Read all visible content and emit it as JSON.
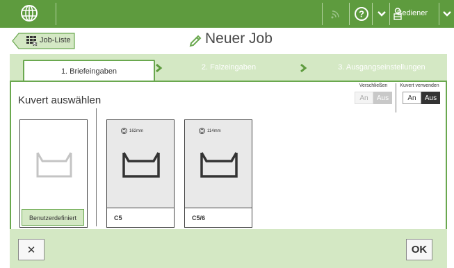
{
  "topbar": {
    "user_label": "Bediener"
  },
  "header": {
    "back_label": "Job-Liste",
    "title": "Neuer Job"
  },
  "tabs": [
    {
      "label": "1. Briefeingaben",
      "active": true
    },
    {
      "label": "2. Falzeingaben",
      "active": false
    },
    {
      "label": "3. Ausgangseinstellungen",
      "active": false
    }
  ],
  "panel": {
    "section_title": "Kuvert auswählen",
    "seal": {
      "label": "Verschließen",
      "on_label": "An",
      "off_label": "Aus",
      "enabled": false
    },
    "use_envelope": {
      "label": "Kuvert verwenden",
      "on_label": "An",
      "off_label": "Aus",
      "selected": "Aus"
    },
    "cards": [
      {
        "name": "Benutzerdefiniert",
        "size": ""
      },
      {
        "name": "C5",
        "size": "162mm"
      },
      {
        "name": "C5/6",
        "size": "114mm"
      }
    ]
  },
  "footer": {
    "cancel_symbol": "✕",
    "ok_label": "OK"
  },
  "colors": {
    "brand_green": "#5e9b3e",
    "light_green": "#d4e8c4",
    "accent_green": "#6aa84f",
    "selected_dark": "#333333"
  }
}
